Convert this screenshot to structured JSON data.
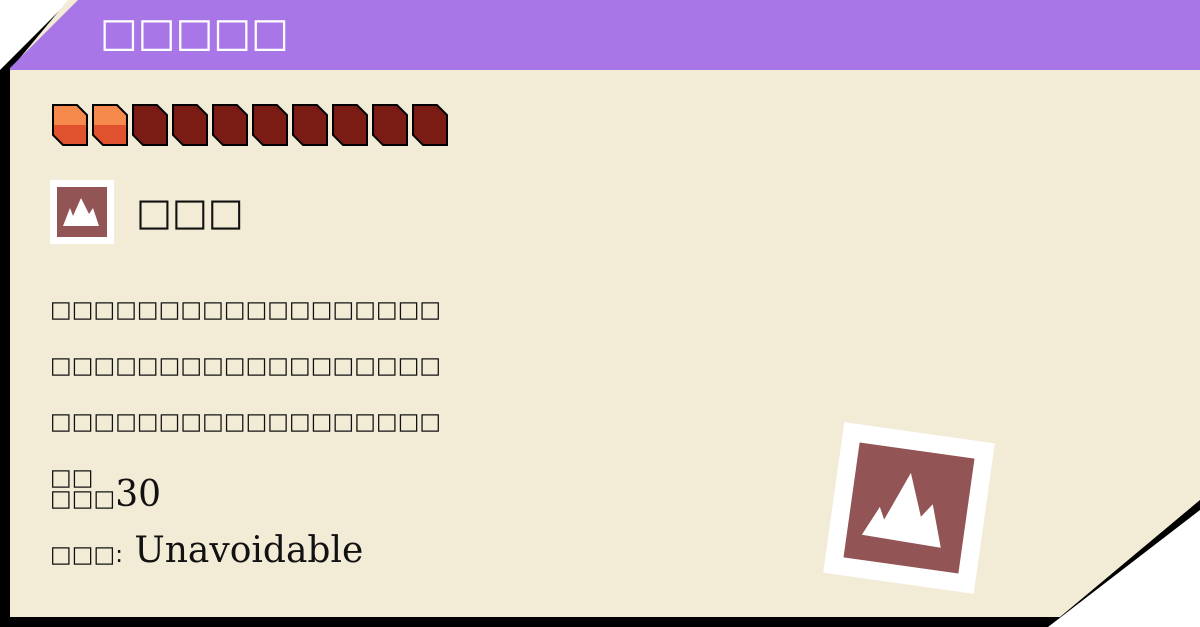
{
  "card": {
    "title": "□□□□□",
    "type_icon": "mountain-icon",
    "type_name": "□□□",
    "description": "□□□□□□□□□□□□□□□□□□□□□□□□□□□□□□□□□□□□□□□□□□□□□□□□□□□□□□□□",
    "power_label": "□□□",
    "power_value": "30",
    "accuracy_label": "□□□:",
    "accuracy_value": "Unavoidable",
    "cost": {
      "total": 10,
      "filled": 2
    }
  },
  "colors": {
    "title_bar": "#a976e8",
    "card_bg": "#f2ebd6",
    "type_color": "#925454",
    "pip_filled_top": "#f58a4c",
    "pip_filled_bottom": "#e0512e",
    "pip_empty": "#7a1c14"
  }
}
